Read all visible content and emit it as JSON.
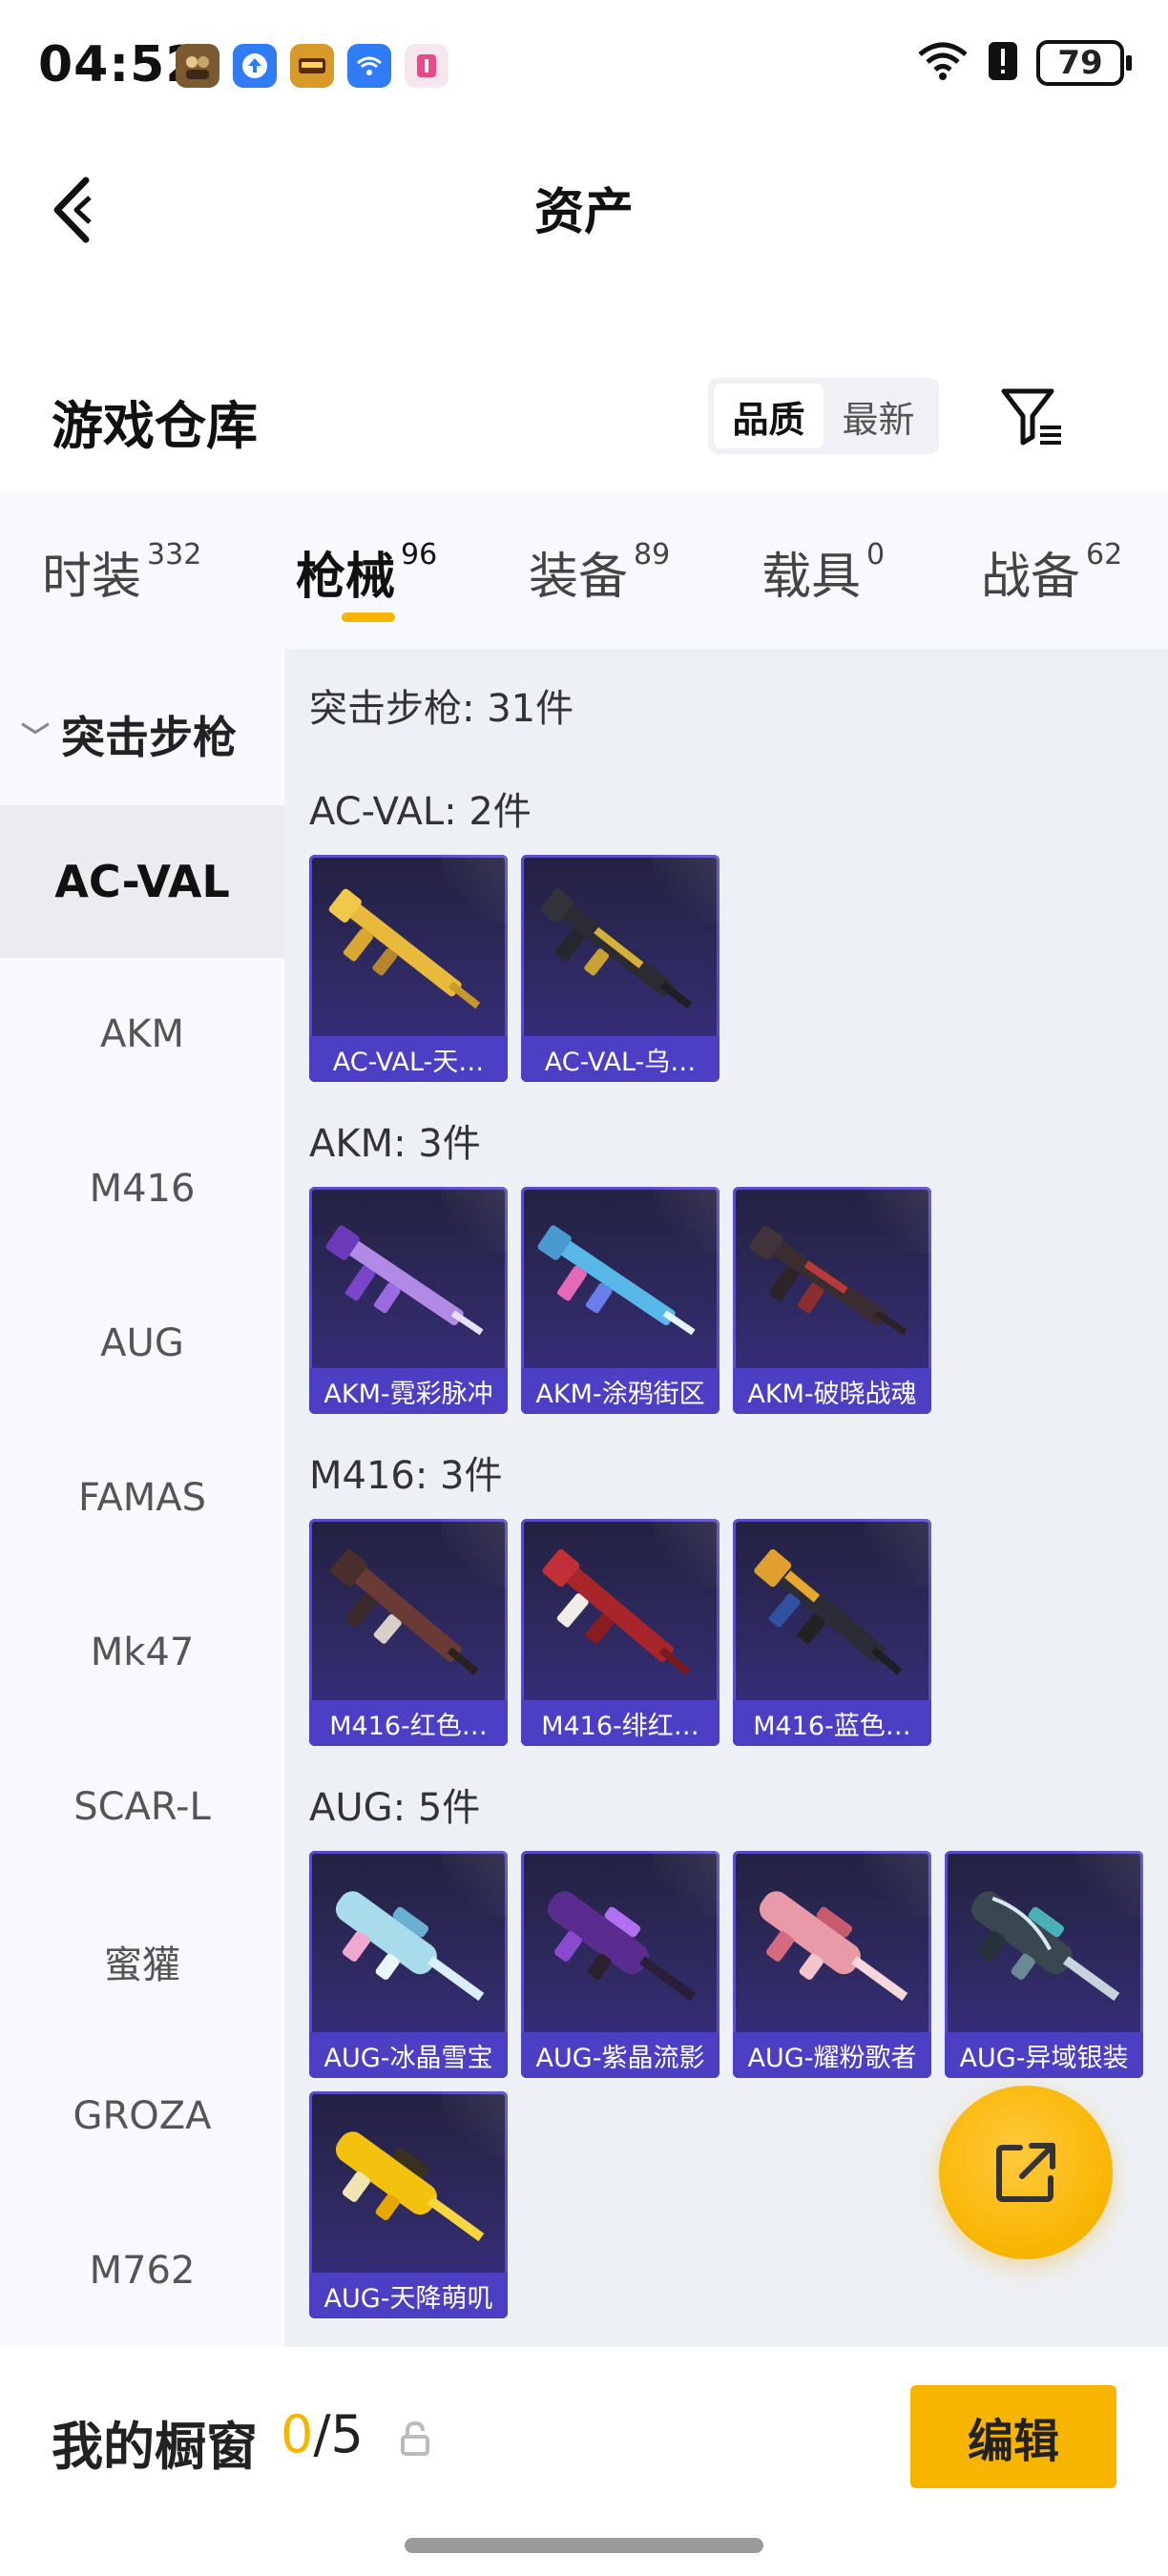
{
  "status_bar": {
    "time": "04:52",
    "battery": "79",
    "apps": [
      {
        "icon": "game-icon",
        "color": "#8a6a3a"
      },
      {
        "icon": "upload-icon",
        "color": "#2f7cf6"
      },
      {
        "icon": "game-icon",
        "color": "#d89b2a"
      },
      {
        "icon": "wifi-app-icon",
        "color": "#2f7cf6"
      },
      {
        "icon": "app-icon",
        "color": "#f3d7e6"
      }
    ]
  },
  "header": {
    "title": "资产"
  },
  "warehouse": {
    "title": "游戏仓库",
    "sort_options": [
      "品质",
      "最新"
    ]
  },
  "tabs": [
    {
      "label": "时装",
      "count": "332"
    },
    {
      "label": "枪械",
      "count": "96"
    },
    {
      "label": "装备",
      "count": "89"
    },
    {
      "label": "载具",
      "count": "0"
    },
    {
      "label": "战备",
      "count": "62"
    }
  ],
  "sidebar": {
    "group": "突击步枪",
    "items": [
      "AC-VAL",
      "AKM",
      "M416",
      "AUG",
      "FAMAS",
      "Mk47",
      "SCAR-L",
      "蜜獾",
      "GROZA",
      "M762"
    ]
  },
  "content": {
    "title": "突击步枪: 31件",
    "groups": [
      {
        "title": "AC-VAL: 2件",
        "items": [
          "AC-VAL-天…",
          "AC-VAL-乌…"
        ]
      },
      {
        "title": "AKM: 3件",
        "items": [
          "AKM-霓彩脉冲",
          "AKM-涂鸦街区",
          "AKM-破晓战魂"
        ]
      },
      {
        "title": "M416: 3件",
        "items": [
          "M416-红色…",
          "M416-绯红…",
          "M416-蓝色…"
        ]
      },
      {
        "title": "AUG: 5件",
        "items": [
          "AUG-冰晶雪宝",
          "AUG-紫晶流影",
          "AUG-耀粉歌者",
          "AUG-异域银装",
          "AUG-天降萌叽"
        ]
      }
    ]
  },
  "bottom_bar": {
    "title": "我的橱窗",
    "current": "0",
    "total": "/5",
    "edit_label": "编辑"
  },
  "colors": {
    "accent": "#f8b500",
    "card_label": "#4c3fc4"
  }
}
